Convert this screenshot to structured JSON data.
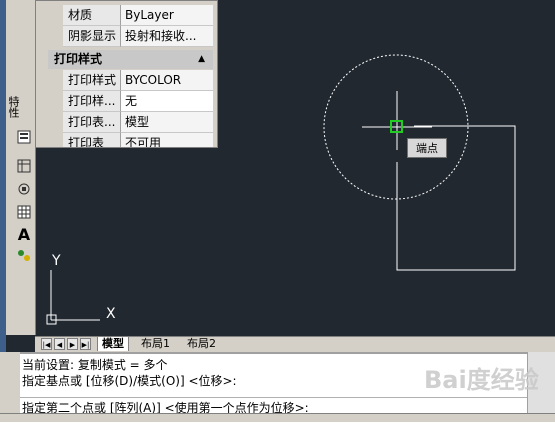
{
  "palette": {
    "title": "特性",
    "tools": [
      "grid-icon",
      "rotate-icon",
      "table-icon",
      "text-icon",
      "dots-icon"
    ]
  },
  "properties": {
    "rows_top": [
      {
        "key": "材质",
        "value": "ByLayer"
      },
      {
        "key": "阴影显示",
        "value": "投射和接收..."
      }
    ],
    "section": "打印样式",
    "rows_section": [
      {
        "key": "打印样式",
        "value": "BYCOLOR"
      },
      {
        "key": "打印样...",
        "value": "无"
      },
      {
        "key": "打印表...",
        "value": "模型"
      },
      {
        "key": "打印表",
        "value": "不可用"
      }
    ]
  },
  "canvas": {
    "tooltip": "端点",
    "ucs": {
      "x_label": "X",
      "y_label": "Y"
    }
  },
  "tabs": {
    "items": [
      "模型",
      "布局1",
      "布局2"
    ],
    "active": "模型"
  },
  "command": {
    "lines": [
      "当前设置:  复制模式 = 多个",
      "指定基点或 [位移(D)/模式(O)] <位移>:"
    ],
    "prompt": "指定第二个点或 [阵列(A)] <使用第一个点作为位移>:"
  },
  "watermark": "Bai度经验",
  "colors": {
    "canvas_bg": "#212830",
    "panel_bg": "#d4d0c8",
    "snap_marker": "#22cc22"
  }
}
